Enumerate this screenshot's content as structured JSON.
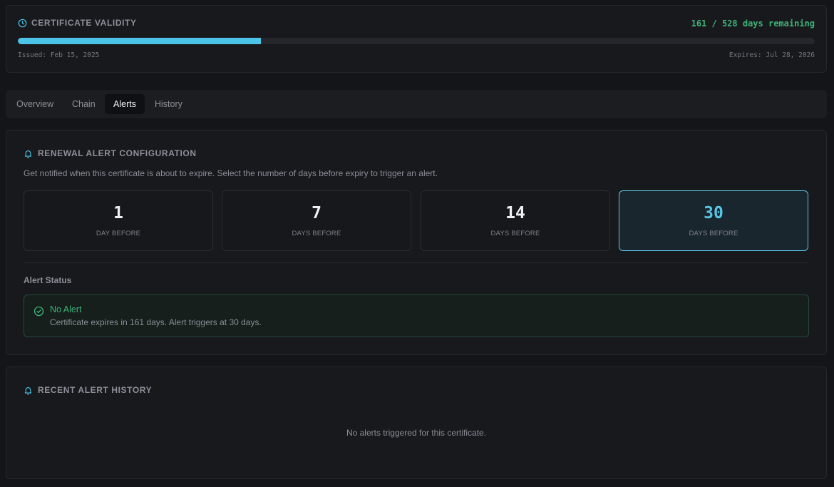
{
  "validity": {
    "title": "CERTIFICATE VALIDITY",
    "remaining": "161 / 528 days remaining",
    "progress_fraction": 0.305,
    "issued": "Issued: Feb 15, 2025",
    "expires": "Expires: Jul 28, 2026",
    "icon": "clock-icon"
  },
  "tabs": [
    {
      "label": "Overview",
      "active": false
    },
    {
      "label": "Chain",
      "active": false
    },
    {
      "label": "Alerts",
      "active": true
    },
    {
      "label": "History",
      "active": false
    }
  ],
  "config": {
    "title": "RENEWAL ALERT CONFIGURATION",
    "description": "Get notified when this certificate is about to expire. Select the number of days before expiry to trigger an alert.",
    "options": [
      {
        "value": "1",
        "label": "DAY BEFORE",
        "selected": false
      },
      {
        "value": "7",
        "label": "DAYS BEFORE",
        "selected": false
      },
      {
        "value": "14",
        "label": "DAYS BEFORE",
        "selected": false
      },
      {
        "value": "30",
        "label": "DAYS BEFORE",
        "selected": true
      }
    ],
    "status_label": "Alert Status",
    "status": {
      "title": "No Alert",
      "text": "Certificate expires in 161 days. Alert triggers at 30 days."
    }
  },
  "history": {
    "title": "RECENT ALERT HISTORY",
    "empty_text": "No alerts triggered for this certificate."
  },
  "colors": {
    "accent": "#4cc4e8",
    "success": "#3fb37a",
    "background": "#141518"
  }
}
